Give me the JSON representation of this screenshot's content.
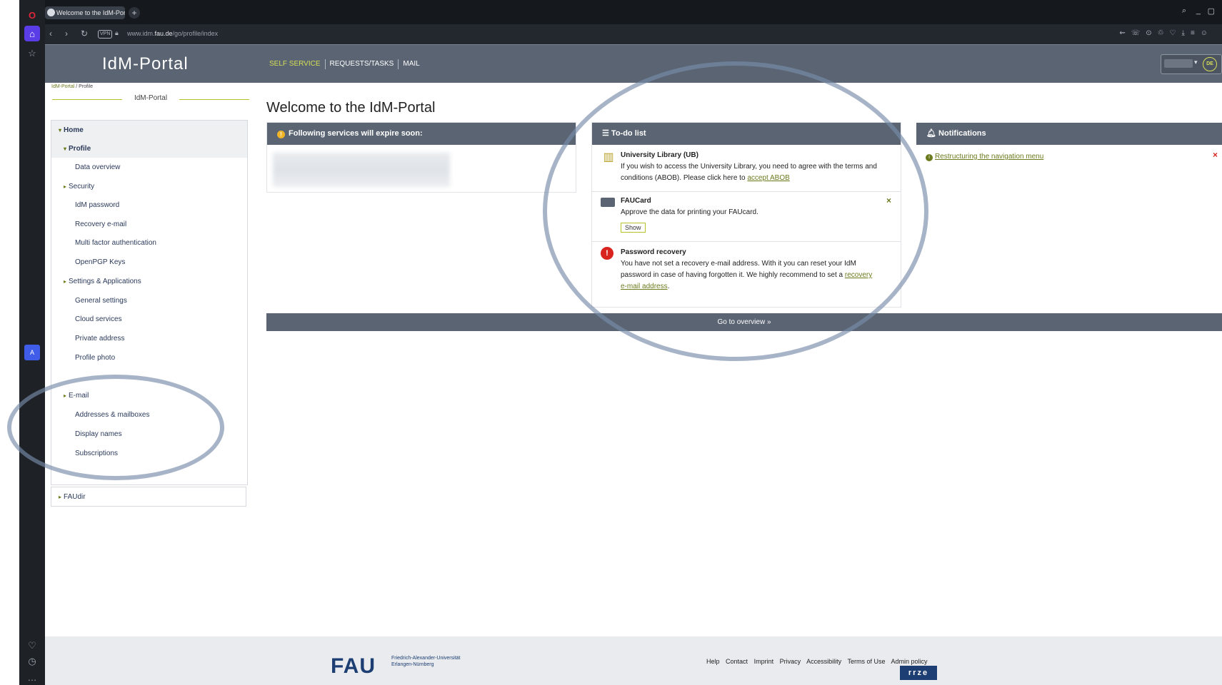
{
  "browser": {
    "tab_title": "Welcome to the IdM-Port",
    "new_tab": "+",
    "url_prefix": "www.idm.",
    "url_domain": "fau.de",
    "url_path": "/go/profile/index",
    "vpn_label": "VPN"
  },
  "header": {
    "logo": "IdM-Portal",
    "nav": [
      "SELF SERVICE",
      "REQUESTS/TASKS",
      "MAIL"
    ],
    "lang": "DE"
  },
  "breadcrumb": {
    "home": "IdM-Portal",
    "sep": "/",
    "current": "Profile"
  },
  "sidebar": {
    "title": "IdM-Portal",
    "items": [
      {
        "label": "Home"
      },
      {
        "label": "Profile"
      },
      {
        "label": "Data overview"
      },
      {
        "label": "Security"
      },
      {
        "label": "IdM password"
      },
      {
        "label": "Recovery e-mail"
      },
      {
        "label": "Multi factor authentication"
      },
      {
        "label": "OpenPGP Keys"
      },
      {
        "label": "Settings & Applications"
      },
      {
        "label": "General settings"
      },
      {
        "label": "Cloud services"
      },
      {
        "label": "Private address"
      },
      {
        "label": "Profile photo"
      },
      {
        "label": "E-mail"
      },
      {
        "label": "Addresses & mailboxes"
      },
      {
        "label": "Display names"
      },
      {
        "label": "Subscriptions"
      }
    ],
    "faudir": "FAUdir"
  },
  "main": {
    "title": "Welcome to the IdM-Portal",
    "expire_panel": {
      "title": "Following services will expire soon:"
    },
    "todo": {
      "title": "To-do list",
      "items": [
        {
          "title": "University Library (UB)",
          "text": "If you wish to access the University Library, you need to agree with the terms and conditions (ABOB). Please click here to",
          "link": "accept ABOB"
        },
        {
          "title": "FAUCard",
          "text": "Approve the data for printing your FAUcard.",
          "button": "Show",
          "close": "×"
        },
        {
          "title": "Password recovery",
          "text": "You have not set a recovery e-mail address. With it you can reset your IdM password in case of having forgotten it. We highly recommend to set a",
          "link": "recovery e-mail address",
          "tail": "."
        }
      ]
    },
    "notifications": {
      "title": "Notifications",
      "item": "Restructuring the navigation menu",
      "close": "×"
    },
    "overview_button": "Go to overview »"
  },
  "footer": {
    "logo": "FAU",
    "logo_sub1": "Friedrich-Alexander-Universität",
    "logo_sub2": "Erlangen-Nürnberg",
    "links": [
      "Help",
      "Contact",
      "Imprint",
      "Privacy",
      "Accessibility",
      "Terms of Use",
      "Admin policy"
    ],
    "rrze": "rrze"
  },
  "colors": {
    "header": "#5a6472",
    "accent": "#b7c12a",
    "link": "#6b7a1d",
    "annotation": "#8797b0"
  }
}
